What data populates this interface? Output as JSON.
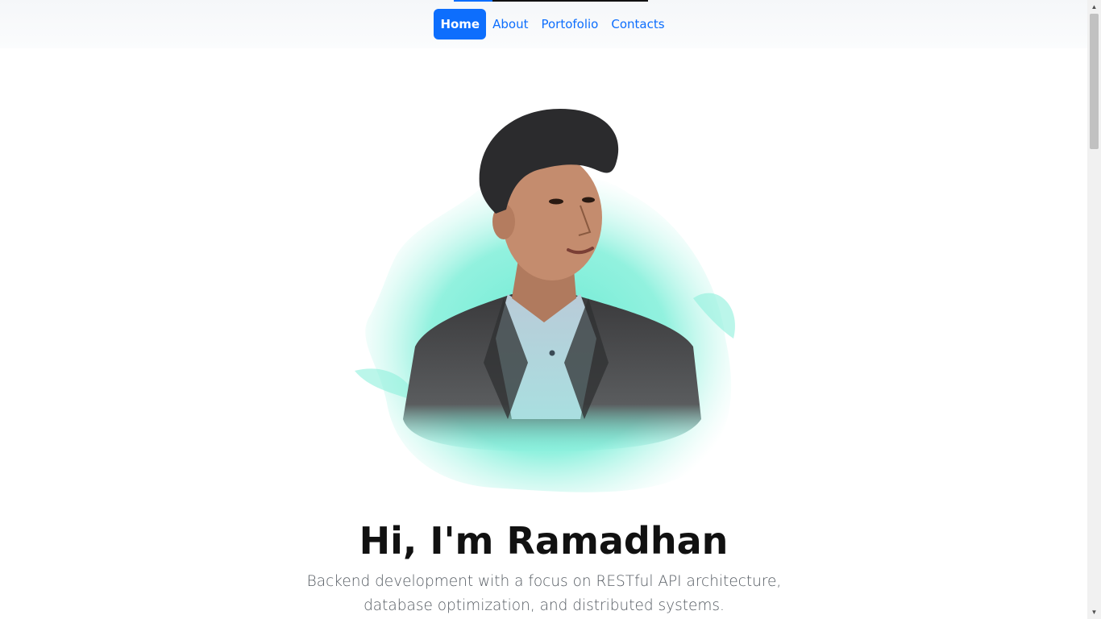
{
  "nav": {
    "items": [
      {
        "label": "Home",
        "active": true
      },
      {
        "label": "About",
        "active": false
      },
      {
        "label": "Portofolio",
        "active": false
      },
      {
        "label": "Contacts",
        "active": false
      }
    ],
    "accent_color": "#0d6efd"
  },
  "hero": {
    "image": "profile-photo-icon",
    "title": "Hi, I'm Ramadhan",
    "subtitle": "Backend development with a focus on RESTful API architecture, database optimization, and distributed systems."
  },
  "scroll_progress": 0.2,
  "scrollbar": {
    "up_icon": "scroll-up-arrow-icon",
    "down_icon": "scroll-down-arrow-icon"
  }
}
